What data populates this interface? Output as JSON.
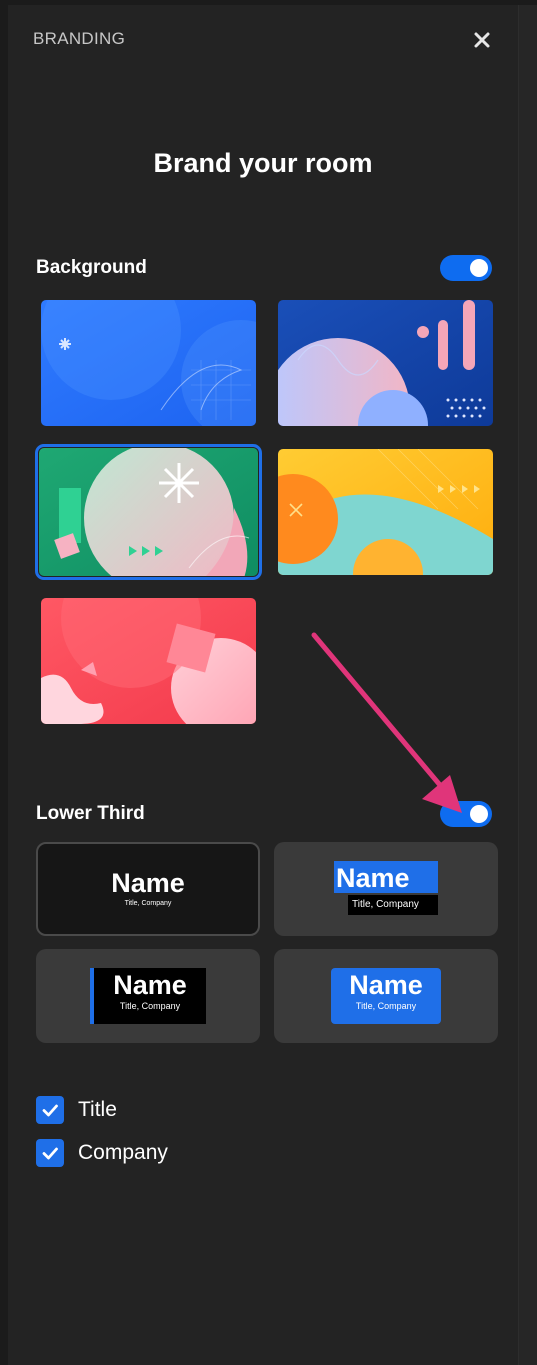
{
  "header": {
    "title": "BRANDING"
  },
  "main": {
    "title": "Brand your room"
  },
  "background": {
    "label": "Background",
    "enabled": true,
    "selected_index": 2,
    "thumbnails": [
      "blue",
      "navy-abstract",
      "green",
      "yellow",
      "red"
    ]
  },
  "lower_third": {
    "label": "Lower Third",
    "enabled": true,
    "selected_index": 0,
    "styles": [
      {
        "name": "Name",
        "sub": "Title, Company"
      },
      {
        "name": "Name",
        "sub": "Title, Company"
      },
      {
        "name": "Name",
        "sub": "Title, Company"
      },
      {
        "name": "Name",
        "sub": "Title, Company"
      }
    ]
  },
  "options": [
    {
      "label": "Title",
      "checked": true
    },
    {
      "label": "Company",
      "checked": true
    }
  ],
  "colors": {
    "accent": "#1f6fe8",
    "panel": "#232323",
    "tile": "#3a3a3a",
    "annotation": "#e0357a"
  }
}
